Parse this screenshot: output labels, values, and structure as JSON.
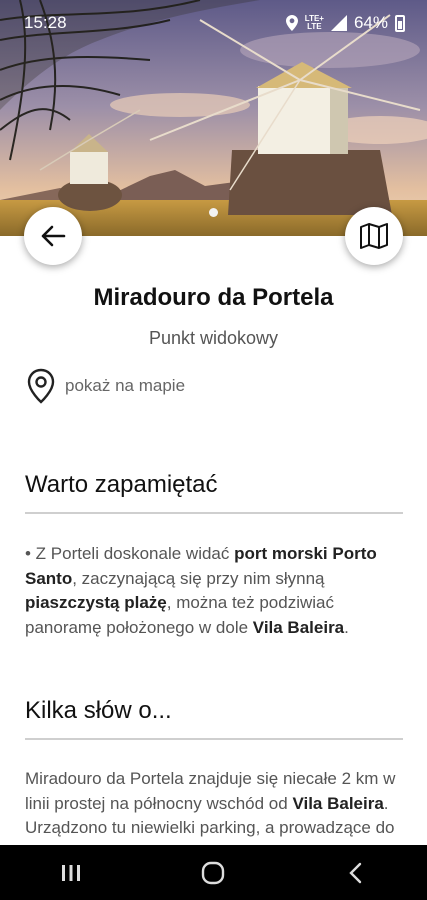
{
  "status_bar": {
    "time": "15:28",
    "network_top": "LTE+",
    "network_bottom": "LTE",
    "battery": "64%"
  },
  "place": {
    "title": "Miradouro da Portela",
    "category": "Punkt widokowy",
    "map_link": "pokaż na mapie"
  },
  "section_remember": {
    "title": "Warto zapamiętać",
    "p1_a": "• Z Porteli doskonale widać ",
    "p1_b": "port morski Porto Santo",
    "p1_c": ", zaczynającą się przy nim słynną ",
    "p1_d": "piaszczystą plażę",
    "p1_e": ", można też podziwiać panoramę położonego w dole ",
    "p1_f": "Vila Baleira",
    "p1_g": "."
  },
  "section_about": {
    "title": "Kilka słów o...",
    "p1_a": "Miradouro da Portela znajduje się niecałe 2 km w linii prostej na północny wschód od ",
    "p1_b": "Vila Baleira",
    "p1_c": ". Urządzono tu niewielki parking, a prowadzące do niego drogi urządzone"
  },
  "icons": {
    "back": "arrow-left-icon",
    "map": "map-icon",
    "pin": "location-pin-icon"
  },
  "colors": {
    "sky_top": "#6f6a93",
    "sky_low": "#e0b899",
    "ground": "#b8923c",
    "windmill_body": "#f1ede0",
    "nav_bar": "#000000"
  }
}
